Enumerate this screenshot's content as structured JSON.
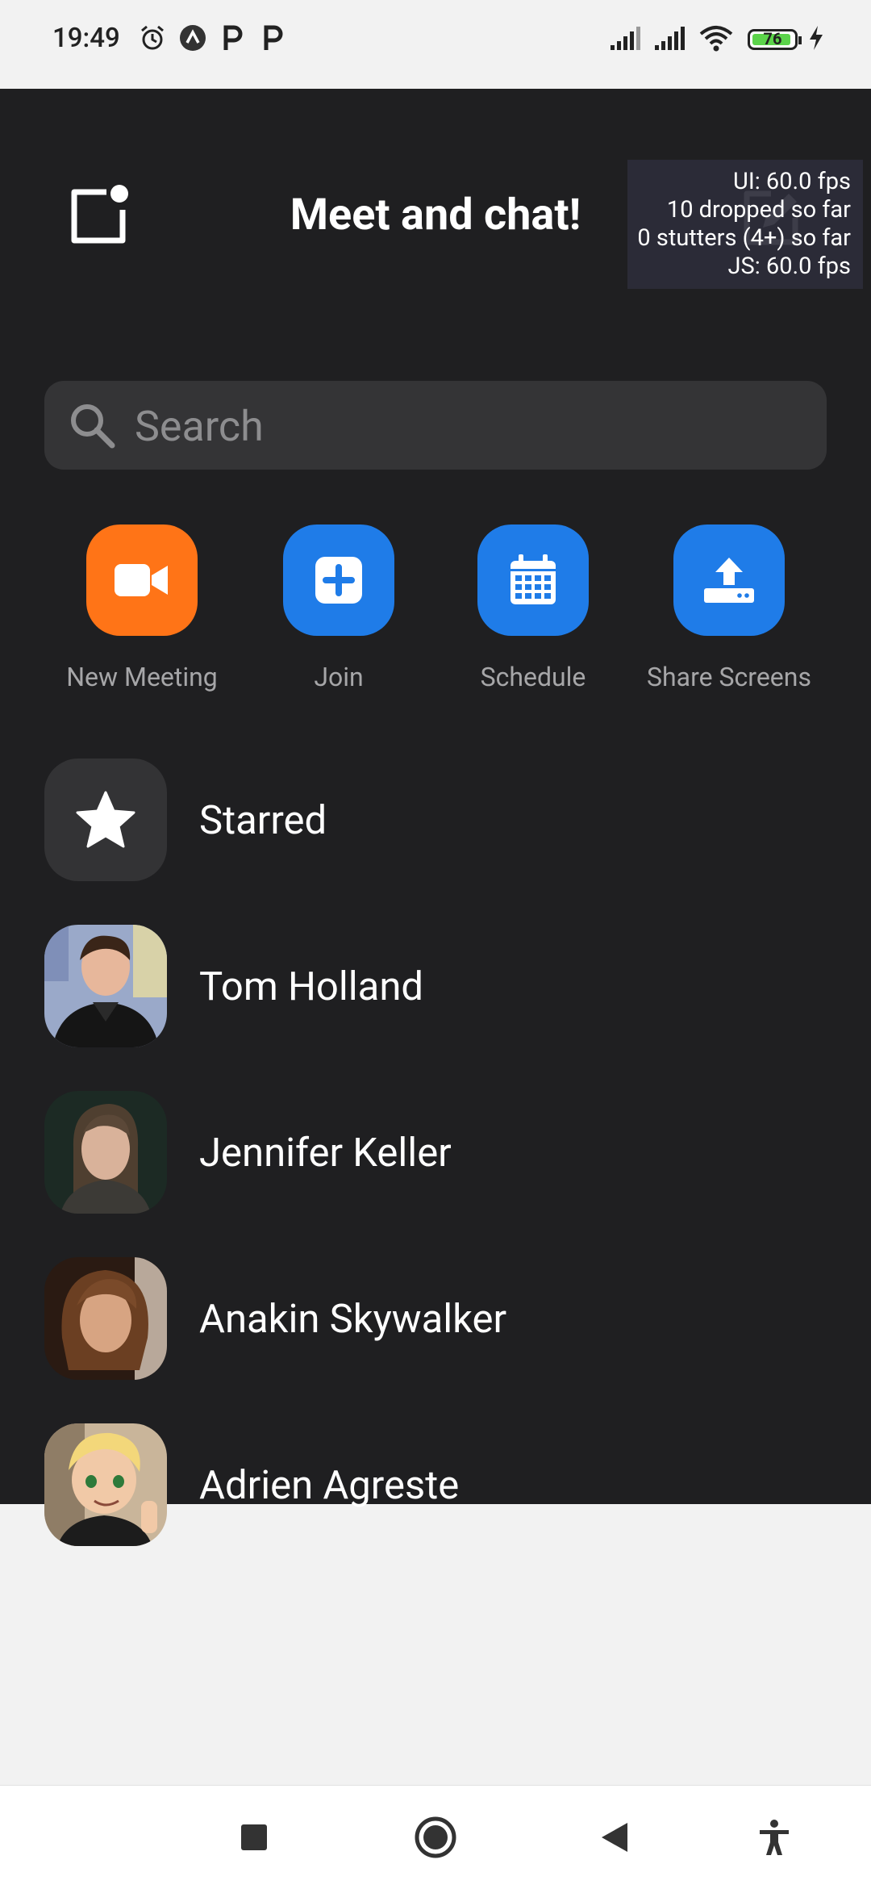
{
  "status_bar": {
    "time": "19:49",
    "battery_percent": "76",
    "icons": [
      "alarm-icon",
      "app-badge-icon",
      "parking-icon",
      "parking-icon",
      "signal-icon",
      "signal-icon",
      "wifi-icon",
      "battery-icon",
      "charging-icon"
    ]
  },
  "perf_overlay": {
    "ui_fps": "UI: 60.0 fps",
    "dropped": "10 dropped so far",
    "stutters": "0 stutters (4+) so far",
    "js_fps": "JS: 60.0 fps"
  },
  "header": {
    "title": "Meet and chat!",
    "left_icon": "notification-square-icon",
    "right_icon": "compose-icon"
  },
  "search": {
    "placeholder": "Search",
    "value": ""
  },
  "actions": [
    {
      "label": "New Meeting",
      "icon": "video-camera-icon",
      "color": "#ff7417"
    },
    {
      "label": "Join",
      "icon": "plus-square-icon",
      "color": "#1f7ce8"
    },
    {
      "label": "Schedule",
      "icon": "calendar-icon",
      "color": "#1f7ce8"
    },
    {
      "label": "Share Screens",
      "icon": "upload-icon",
      "color": "#1f7ce8"
    }
  ],
  "contacts": [
    {
      "name": "Starred",
      "icon": "star-icon"
    },
    {
      "name": "Tom Holland"
    },
    {
      "name": "Jennifer Keller"
    },
    {
      "name": "Anakin Skywalker"
    },
    {
      "name": "Adrien Agreste"
    }
  ],
  "colors": {
    "background_dark": "#1f1f21",
    "search_bg": "#343436",
    "orange": "#ff7417",
    "blue": "#1f7ce8"
  }
}
